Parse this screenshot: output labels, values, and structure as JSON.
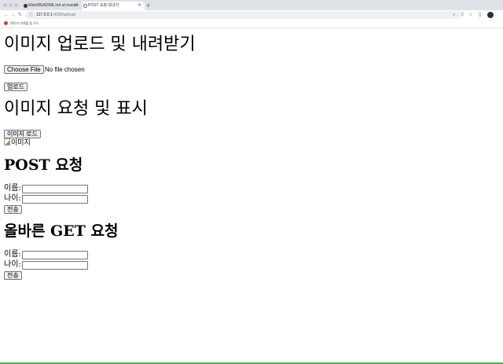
{
  "browser": {
    "tabs": [
      {
        "title": "Web/README.md at master · "
      },
      {
        "title": "POST 요청 보내기"
      }
    ],
    "url_host": "127.0.0.1",
    "url_port_path": ":4200/upload",
    "bookmark_label": "웨이브 대체를 할 수도..."
  },
  "upload": {
    "heading": "이미지 업로드 및 내려받기",
    "choose_file_label": "Choose File",
    "no_file_text": "No file chosen",
    "upload_button": "업로드"
  },
  "image_request": {
    "heading": "이미지 요청 및 표시",
    "load_button": "이미지 로드",
    "image_alt": "이미지"
  },
  "post_form": {
    "heading": "POST 요청",
    "name_label": "이름:",
    "age_label": "나이:",
    "submit_button": "전송"
  },
  "get_form": {
    "heading": "올바른 GET 요청",
    "name_label": "이름:",
    "age_label": "나이:",
    "submit_button": "전송"
  }
}
